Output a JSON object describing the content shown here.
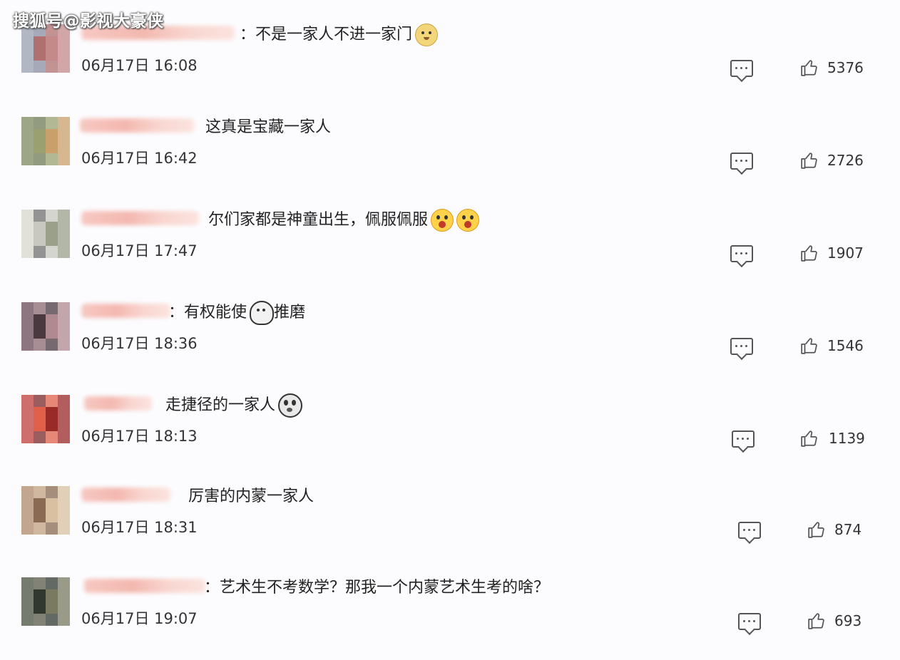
{
  "watermark": "搜狐号@影视大豪侠",
  "comments": [
    {
      "text": "：不是一家人不进一家门",
      "emoji": "doge",
      "time": "06月17日 16:08",
      "likes": "5376",
      "avatar_colors": [
        "#9aa0b0",
        "#c48a8a",
        "#b07070",
        "#8a8fa0"
      ]
    },
    {
      "text": "这真是宝藏一家人",
      "emoji": "",
      "time": "06月17日 16:42",
      "likes": "2726",
      "avatar_colors": [
        "#7f8a60",
        "#c9a06a",
        "#9aa070",
        "#6f7a55"
      ]
    },
    {
      "text": "尔们家都是神童出生，佩服佩服",
      "emoji": "shock",
      "time": "06月17日 17:47",
      "likes": "1907",
      "avatar_colors": [
        "#d8d8cc",
        "#9aa08a",
        "#c8c8c0",
        "#707070"
      ]
    },
    {
      "text": "：有权能使",
      "text2": "推磨",
      "emoji": "ghost",
      "time": "06月17日 18:36",
      "likes": "1546",
      "avatar_colors": [
        "#6a4a55",
        "#b08a90",
        "#4a3a40",
        "#8a6a70"
      ]
    },
    {
      "text": "走捷径的一家人",
      "emoji": "cry",
      "time": "06月17日 18:13",
      "likes": "1139",
      "avatar_colors": [
        "#c0403a",
        "#9a2a28",
        "#e0604a",
        "#7a2a2a"
      ]
    },
    {
      "text": "厉害的内蒙一家人",
      "emoji": "",
      "time": "06月17日 18:31",
      "likes": "874",
      "avatar_colors": [
        "#b08a6a",
        "#d8c0a0",
        "#8a6a50",
        "#c0a080"
      ]
    },
    {
      "text": "：艺术生不考数学？那我一个内蒙艺术生考的啥？",
      "emoji": "",
      "time": "06月17日 19:07",
      "likes": "693",
      "avatar_colors": [
        "#4a5040",
        "#7a7a60",
        "#303830",
        "#5a5a48"
      ]
    }
  ],
  "icons": {
    "reply": "comment-icon",
    "like": "thumbs-up-icon"
  }
}
